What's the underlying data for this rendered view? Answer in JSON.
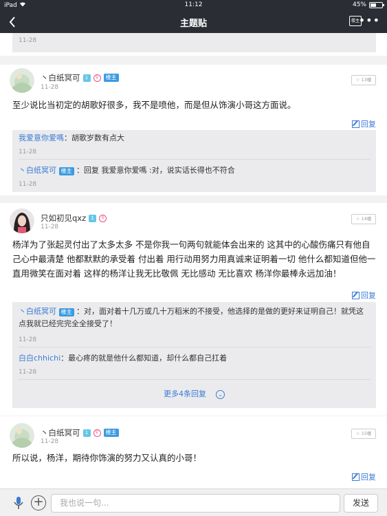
{
  "status": {
    "device": "iPad",
    "time": "11:12",
    "battery": "45%"
  },
  "nav": {
    "title": "主题贴",
    "landlord_btn": "楼主"
  },
  "top_fragment": {
    "time": "11-28"
  },
  "posts": [
    {
      "author": "丶白纸冥可",
      "level": "1",
      "owner_badge": "楼主",
      "time": "11-28",
      "floor": "13楼",
      "text": "至少说比当初定的胡歌好很多，我不是喷他，而是但从饰演小哥这方面说。",
      "reply_label": "回复",
      "replies": [
        {
          "name": "我爱意你爱嗎",
          "badge": "",
          "text": "：胡歌岁数有点大",
          "time": "11-28"
        },
        {
          "name": "丶白纸冥可",
          "badge": "楼主",
          "text": "：回复 我爱意你爱嗎 :对，说实话长得也不符合",
          "time": "11-28"
        }
      ]
    },
    {
      "author": "只如初见qxz",
      "level": "1",
      "owner_badge": "",
      "time": "11-28",
      "floor": "14楼",
      "text": "杨洋为了张起灵付出了太多太多 不是你我一句两句就能体会出来的 这其中的心酸伤痛只有他自己心中最清楚 他都默默的承受着 付出着 用行动用努力用真诚来证明着一切 他什么都知道但他一直用微笑在面对着 这样的杨洋让我无比敬佩 无比感动 无比喜欢 杨洋你最棒永远加油！",
      "reply_label": "回复",
      "replies": [
        {
          "name": "丶白纸冥可",
          "badge": "楼主",
          "text": "：对，面对着十几万或几十万稻米的不接受，他选择的是做的更好来证明自己！就凭这点我就已经完完全全接受了！",
          "time": "11-28"
        },
        {
          "name": "白白chhichi",
          "badge": "",
          "text": "：最心疼的就是他什么都知道，却什么都自己扛着",
          "time": "11-28"
        }
      ],
      "more_replies": "更多4条回复"
    },
    {
      "author": "丶白纸冥可",
      "level": "1",
      "owner_badge": "楼主",
      "time": "11-28",
      "floor": "15楼",
      "text": "所以说，杨洋，期待你饰演的努力又认真的小哥！",
      "reply_label": "回复"
    }
  ],
  "input": {
    "placeholder": "我也说一句...",
    "send_label": "发送"
  }
}
